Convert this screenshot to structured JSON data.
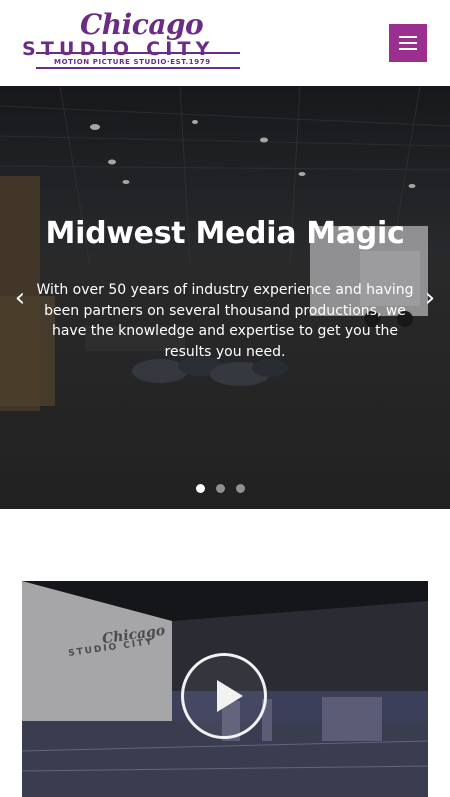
{
  "header": {
    "logo": {
      "script": "Chicago",
      "main": "STUDIO CITY",
      "tagline": "MOTION PICTURE STUDIO·EST.1979"
    },
    "menu_icon": "hamburger-menu-icon",
    "menu_color": "#9a2f8f"
  },
  "hero": {
    "title": "Midwest Media Magic",
    "text": "With over 50 years of industry experience and having been partners on several thousand productions, we have the knowledge and expertise to get you the results you need.",
    "prev_icon": "‹",
    "next_icon": "›",
    "slide_count": 3,
    "active_slide": 1
  },
  "video": {
    "wall_script": "Chicago",
    "wall_main": "STUDIO CITY",
    "play_icon": "play-icon"
  },
  "colors": {
    "brand_purple": "#6b2c86",
    "menu_magenta": "#9a2f8f"
  }
}
